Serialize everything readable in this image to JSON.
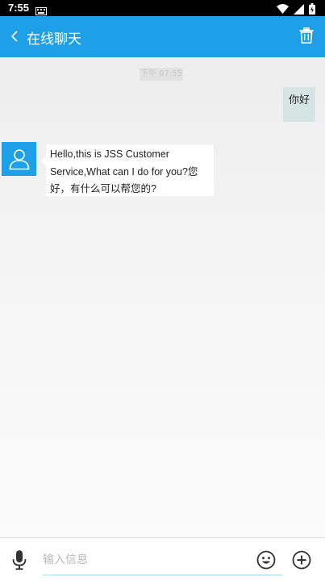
{
  "status": {
    "time": "7:55"
  },
  "header": {
    "title": "在线聊天"
  },
  "chat": {
    "timestamp": "下午 07:55",
    "messages": [
      {
        "side": "right",
        "text": "你好"
      },
      {
        "side": "left",
        "text": "Hello,this is JSS Customer Service,What can I do for you?您好，有什么可以帮您的?"
      }
    ]
  },
  "input": {
    "placeholder": "输入信息"
  },
  "colors": {
    "accent": "#1ea0e8",
    "self_bubble": "#d4e5e3"
  }
}
